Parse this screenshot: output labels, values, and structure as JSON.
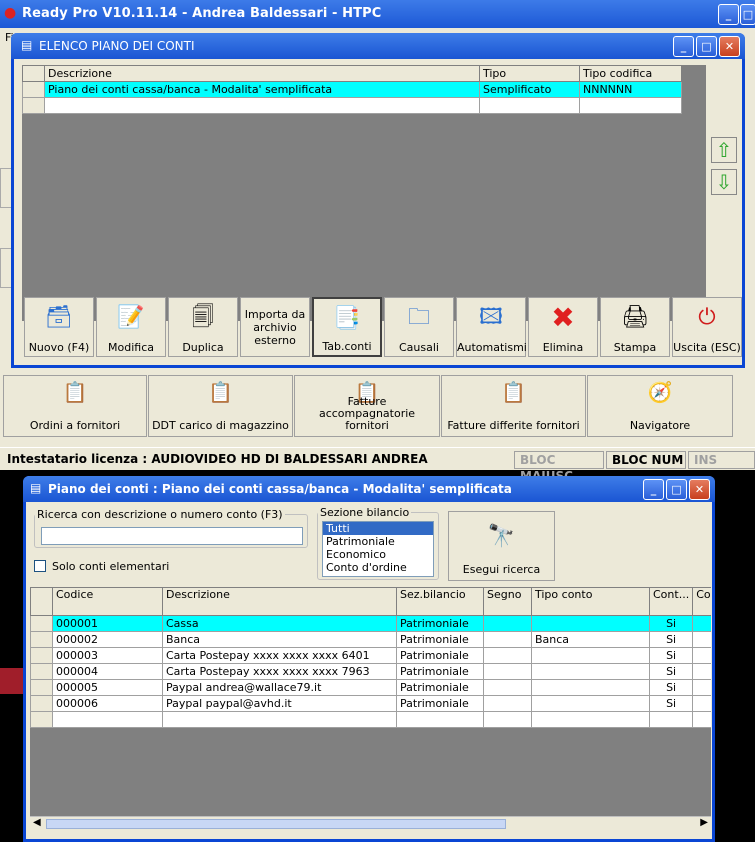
{
  "app": {
    "title": "Ready Pro V10.11.14 - Andrea Baldessari - HTPC",
    "menu_first": "Fi"
  },
  "plan_window": {
    "title": "ELENCO PIANO DEI CONTI",
    "columns": [
      "Descrizione",
      "Tipo",
      "Tipo codifica"
    ],
    "rows": [
      {
        "descrizione": "Piano dei conti cassa/banca - Modalita' semplificata",
        "tipo": "Semplificato",
        "tipo_codifica": "NNNNNN"
      }
    ],
    "toolbar": [
      {
        "label": "Nuovo (F4)",
        "icon": "new-icon"
      },
      {
        "label": "Modifica",
        "icon": "edit-icon"
      },
      {
        "label": "Duplica",
        "icon": "duplicate-icon"
      },
      {
        "label": "Importa da archivio esterno",
        "icon": ""
      },
      {
        "label": "Tab.conti",
        "icon": "tree-icon"
      },
      {
        "label": "Causali",
        "icon": "window-icon"
      },
      {
        "label": "Automatismi",
        "icon": "table-icon"
      },
      {
        "label": "Elimina",
        "icon": "delete-icon"
      },
      {
        "label": "Stampa",
        "icon": "printer-icon"
      },
      {
        "label": "Uscita (ESC)",
        "icon": "exit-icon"
      }
    ]
  },
  "main_buttons": [
    {
      "label": "Ordini a fornitori"
    },
    {
      "label": "DDT carico di magazzino"
    },
    {
      "label": "Fatture accompagnatorie fornitori"
    },
    {
      "label": "Fatture differite fornitori"
    },
    {
      "label": "Navigatore"
    }
  ],
  "status_bar": {
    "license": "Intestatario licenza : AUDIOVIDEO HD DI BALDESSARI ANDREA",
    "caps": "BLOC MAIUSC",
    "num": "BLOC NUM",
    "ins": "INS"
  },
  "accounts_window": {
    "title": "Piano dei conti : Piano dei conti cassa/banca - Modalita' semplificata",
    "search_legend": "Ricerca con descrizione o numero conto (F3)",
    "search_value": "",
    "only_elementary": "Solo conti elementari",
    "sezione_legend": "Sezione bilancio",
    "sezione_options": [
      "Tutti",
      "Patrimoniale",
      "Economico",
      "Conto d'ordine"
    ],
    "sezione_selected": "Tutti",
    "search_button": "Esegui ricerca",
    "columns": [
      "Codice",
      "Descrizione",
      "Sez.bilancio",
      "Segno",
      "Tipo conto",
      "Cont...",
      "Co"
    ],
    "rows": [
      {
        "codice": "000001",
        "descrizione": "Cassa",
        "sez": "Patrimoniale",
        "segno": "",
        "tipo": "",
        "cont": "Si"
      },
      {
        "codice": "000002",
        "descrizione": "Banca",
        "sez": "Patrimoniale",
        "segno": "",
        "tipo": "Banca",
        "cont": "Si"
      },
      {
        "codice": "000003",
        "descrizione": "Carta Postepay xxxx xxxx xxxx 6401",
        "sez": "Patrimoniale",
        "segno": "",
        "tipo": "",
        "cont": "Si"
      },
      {
        "codice": "000004",
        "descrizione": "Carta Postepay xxxx xxxx xxxx 7963",
        "sez": "Patrimoniale",
        "segno": "",
        "tipo": "",
        "cont": "Si"
      },
      {
        "codice": "000005",
        "descrizione": "Paypal andrea@wallace79.it",
        "sez": "Patrimoniale",
        "segno": "",
        "tipo": "",
        "cont": "Si"
      },
      {
        "codice": "000006",
        "descrizione": "Paypal paypal@avhd.it",
        "sez": "Patrimoniale",
        "segno": "",
        "tipo": "",
        "cont": "Si"
      }
    ]
  },
  "colors": {
    "selection": "#00ffff",
    "titlebar": "#1c58d6",
    "grid_bg": "#808080"
  }
}
